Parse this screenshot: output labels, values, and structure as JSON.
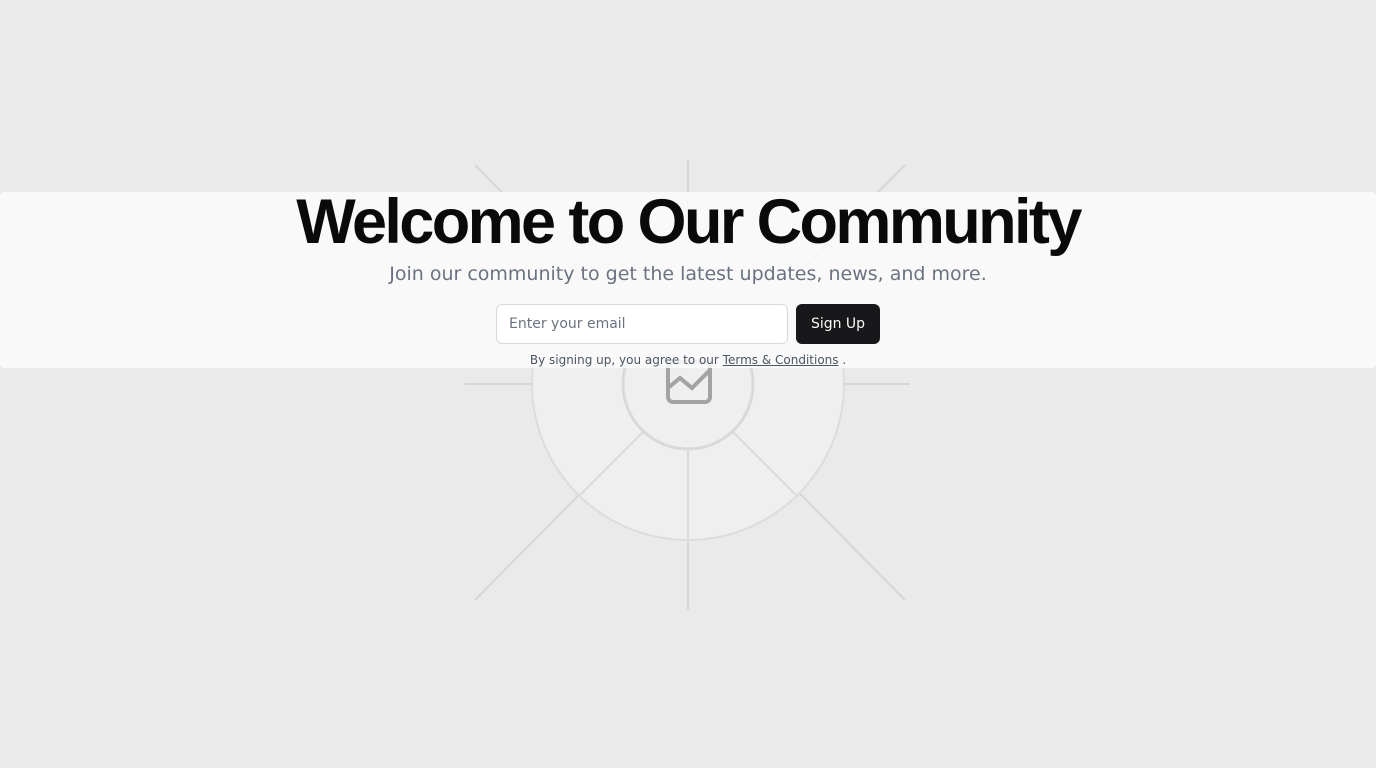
{
  "hero": {
    "title": "Welcome to Our Community",
    "subtitle": "Join our community to get the latest updates, news, and more."
  },
  "signup": {
    "email_placeholder": "Enter your email",
    "button_label": "Sign Up",
    "terms_prefix": "By signing up, you agree to our ",
    "terms_link": "Terms & Conditions",
    "terms_suffix": " ."
  },
  "background": {
    "icon": "image-placeholder-icon"
  },
  "colors": {
    "background": "#eaeaea",
    "panel": "#fafafa",
    "title": "#0a0a0a",
    "subtitle": "#6b7280",
    "button": "#18181b",
    "button_text": "#fafafa"
  }
}
